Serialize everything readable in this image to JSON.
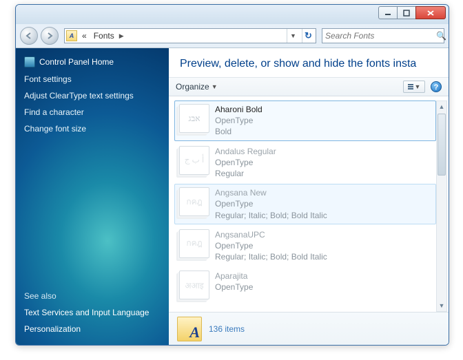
{
  "titlebar": {},
  "address": {
    "crumb_prefix": "«",
    "crumb": "Fonts"
  },
  "search": {
    "placeholder": "Search Fonts"
  },
  "sidebar": {
    "home": "Control Panel Home",
    "links": [
      "Font settings",
      "Adjust ClearType text settings",
      "Find a character",
      "Change font size"
    ],
    "seealso_header": "See also",
    "seealso": [
      "Text Services and Input Language",
      "Personalization"
    ]
  },
  "main": {
    "heading": "Preview, delete, or show and hide the fonts insta",
    "organize": "Organize",
    "fonts": [
      {
        "name": "Aharoni Bold",
        "type": "OpenType",
        "styles": "Bold",
        "sample": "אבג",
        "state": "selected",
        "dim": false
      },
      {
        "name": "Andalus Regular",
        "type": "OpenType",
        "styles": "Regular",
        "sample": "أ ب ج",
        "state": "",
        "dim": true
      },
      {
        "name": "Angsana New",
        "type": "OpenType",
        "styles": "Regular; Italic; Bold; Bold Italic",
        "sample": "กคฎ",
        "state": "hover",
        "dim": true
      },
      {
        "name": "AngsanaUPC",
        "type": "OpenType",
        "styles": "Regular; Italic; Bold; Bold Italic",
        "sample": "กคฎ",
        "state": "",
        "dim": true
      },
      {
        "name": "Aparajita",
        "type": "OpenType",
        "styles": "",
        "sample": "अआइ",
        "state": "",
        "dim": true
      }
    ],
    "details_count": "136 items"
  }
}
